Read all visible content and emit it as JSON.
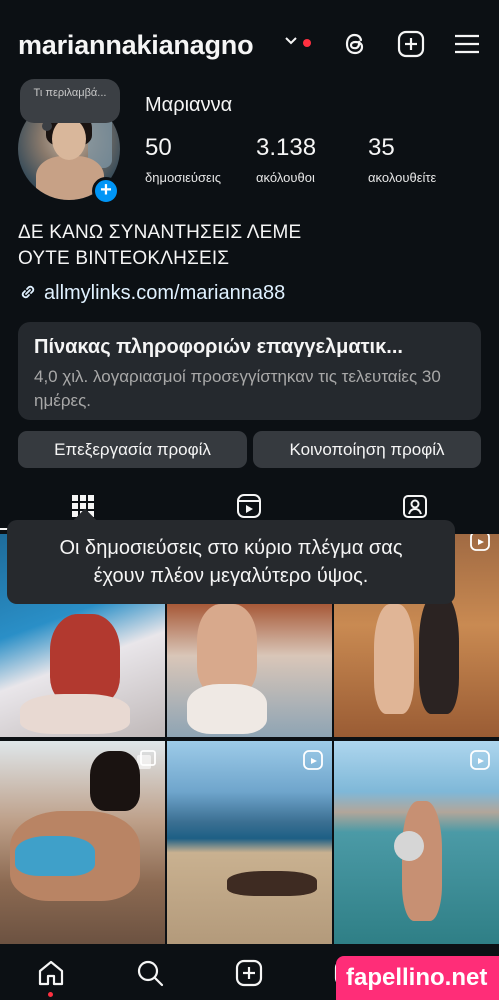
{
  "header": {
    "username": "mariannakianagno",
    "icons": [
      "chevron-down-icon",
      "threads-icon",
      "create-icon",
      "menu-icon"
    ]
  },
  "profile": {
    "note": "Τι περιλαμβά...",
    "full_name": "Μαριαννα",
    "stats": [
      {
        "value": "50",
        "label": "δημοσιεύσεις"
      },
      {
        "value": "3.138",
        "label": "ακόλουθοι"
      },
      {
        "value": "35",
        "label": "ακολουθείτε"
      }
    ],
    "bio_line1": "ΔΕ ΚΑΝΩ ΣΥΝΑΝΤΗΣΕΙΣ ΛΕΜΕ",
    "bio_line2": "ΟΥΤΕ ΒΙΝΤΕΟΚΛΗΣΕΙΣ",
    "link": "allmylinks.com/marianna88"
  },
  "dashboard": {
    "title": "Πίνακας πληροφοριών επαγγελματικ...",
    "subtitle": "4,0 χιλ. λογαριασμοί προσεγγίστηκαν τις τελευταίες 30 ημέρες."
  },
  "buttons": {
    "edit": "Επεξεργασία προφίλ",
    "share": "Κοινοποίηση προφίλ"
  },
  "tabs": [
    "grid-icon",
    "reels-icon",
    "tagged-icon"
  ],
  "tooltip": {
    "line1": "Οι δημοσιεύσεις στο κύριο πλέγμα σας",
    "line2": "έχουν πλέον μεγαλύτερο ύψος."
  },
  "bottom_nav": [
    "home-icon",
    "search-icon",
    "create-icon",
    "reels-icon",
    "profile-avatar"
  ],
  "watermark": "fapellino.net",
  "colors": {
    "background": "#0c1014",
    "accent": "#0095f6",
    "notification": "#ff3040",
    "watermark": "#ff2d78"
  }
}
